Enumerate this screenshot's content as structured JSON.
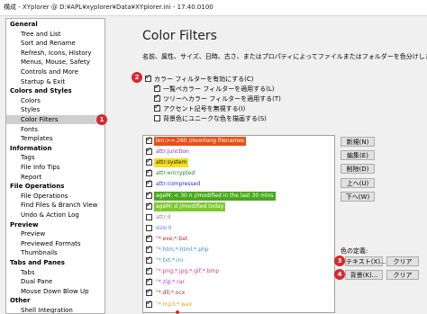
{
  "window": {
    "title": "構成 - XYplorer @ D:¥APL¥xyplorer¥Data¥XYplorer.ini - 17.40.0100"
  },
  "sidebar": {
    "rows": [
      {
        "kind": "cat",
        "label": "General"
      },
      {
        "kind": "item",
        "label": "Tree and List"
      },
      {
        "kind": "item",
        "label": "Sort and Rename"
      },
      {
        "kind": "item",
        "label": "Refresh, Icons, History"
      },
      {
        "kind": "item",
        "label": "Menus, Mouse, Safety"
      },
      {
        "kind": "item",
        "label": "Controls and More"
      },
      {
        "kind": "item",
        "label": "Startup & Exit"
      },
      {
        "kind": "cat",
        "label": "Colors and Styles"
      },
      {
        "kind": "item",
        "label": "Colors"
      },
      {
        "kind": "item",
        "label": "Styles"
      },
      {
        "kind": "item",
        "label": "Color Filters",
        "selected": true
      },
      {
        "kind": "item",
        "label": "Fonts"
      },
      {
        "kind": "item",
        "label": "Templates"
      },
      {
        "kind": "cat",
        "label": "Information"
      },
      {
        "kind": "item",
        "label": "Tags"
      },
      {
        "kind": "item",
        "label": "File Info Tips"
      },
      {
        "kind": "item",
        "label": "Report"
      },
      {
        "kind": "cat",
        "label": "File Operations"
      },
      {
        "kind": "item",
        "label": "File Operations"
      },
      {
        "kind": "item",
        "label": "Find Files & Branch View"
      },
      {
        "kind": "item",
        "label": "Undo & Action Log"
      },
      {
        "kind": "cat",
        "label": "Preview"
      },
      {
        "kind": "item",
        "label": "Preview"
      },
      {
        "kind": "item",
        "label": "Previewed Formats"
      },
      {
        "kind": "item",
        "label": "Thumbnails"
      },
      {
        "kind": "cat",
        "label": "Tabs and Panes"
      },
      {
        "kind": "item",
        "label": "Tabs"
      },
      {
        "kind": "item",
        "label": "Dual Pane"
      },
      {
        "kind": "item",
        "label": "Mouse Down Blow Up"
      },
      {
        "kind": "cat",
        "label": "Other"
      },
      {
        "kind": "item",
        "label": "Shell Integration"
      }
    ]
  },
  "main": {
    "title": "Color Filters",
    "description": "名前、属性、サイズ、日時、古さ、またはプロパティによってファイルまたはフォルダーを色分けします。",
    "enable_label": "カラー フィルターを有効にする(C)",
    "options": [
      {
        "label": "一覧ペカラー フィルターを適用する(L)",
        "checked": true
      },
      {
        "label": "ツリーへカラー フィルターを適用する(T)",
        "checked": true
      },
      {
        "label": "アクセント記号を無視する(I)",
        "checked": true
      },
      {
        "label": "背景色にユニークな色を描画する(S)",
        "checked": false
      }
    ]
  },
  "filters": [
    {
      "text": "len:>=.260 //overlong filenames",
      "fg": "#ffffff",
      "bg": "#e84f16",
      "checked": true
    },
    {
      "text": "attr:junction",
      "fg": "#7a2fb0",
      "bg": "",
      "checked": true
    },
    {
      "text": "attr:system",
      "fg": "#222222",
      "bg": "#f2e01c",
      "checked": true
    },
    {
      "text": "attr:encrypted",
      "fg": "#1a8a2a",
      "bg": "",
      "checked": true
    },
    {
      "text": "attr:compressed",
      "fg": "#1c2fd0",
      "bg": "",
      "checked": true
    },
    {
      "text": "ageM: < 30 n //modified in the last 30 mins",
      "fg": "#ffffff",
      "bg": "#4aa81e",
      "checked": true
    },
    {
      "text": "ageM: d //modified today",
      "fg": "#ffffff",
      "bg": "#7ec82e",
      "checked": true
    },
    {
      "text": "attr:d",
      "fg": "#8a8a8a",
      "bg": "",
      "checked": false
    },
    {
      "text": "size:0",
      "fg": "#5a7ee8",
      "bg": "",
      "checked": false
    },
    {
      "text": "\"*.exe;*.bat",
      "fg": "#d02a2a",
      "bg": "",
      "checked": true
    },
    {
      "text": "\"*.htm;*.html;*.php",
      "fg": "#3a8ae0",
      "bg": "",
      "checked": true
    },
    {
      "text": "\"*.txt;*.ini",
      "fg": "#2e9a8a",
      "bg": "",
      "checked": true
    },
    {
      "text": "\"*.png;*.jpg;*.gif;*.bmp",
      "fg": "#d03a8a",
      "bg": "",
      "checked": true
    },
    {
      "text": "\"*.zip;*.rar",
      "fg": "#b03ad0",
      "bg": "",
      "checked": true
    },
    {
      "text": "\"*.dll;*.ocx",
      "fg": "#8a3a3a",
      "bg": "",
      "checked": true
    },
    {
      "text": "\"*.mp3;*.wav",
      "fg": "#e8a020",
      "bg": "",
      "checked": true
    }
  ],
  "buttons": {
    "new": "新規(N)",
    "edit": "編集(E)",
    "delete": "削除(D)",
    "up": "上へ(U)",
    "down": "下へ(W)",
    "color_def": "色の定義:",
    "text": "テキスト(X)...",
    "clear1": "クリア",
    "back": "背景(K)...",
    "clear2": "クリア"
  },
  "badges": {
    "b1": "1",
    "b2": "2",
    "b3": "3",
    "b4": "4"
  },
  "colors": {
    "badge": "#d9272e",
    "selection": "#cfcfcf"
  }
}
